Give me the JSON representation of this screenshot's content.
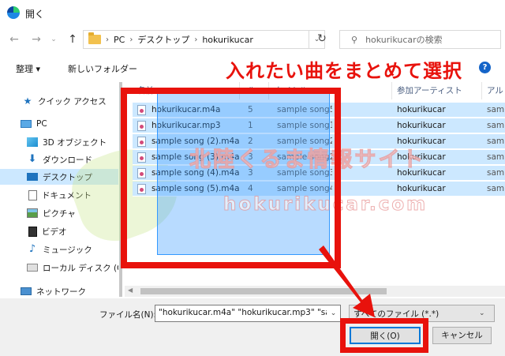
{
  "window": {
    "title": "開く"
  },
  "nav": {
    "back_icon": "arrow-left-icon",
    "forward_icon": "arrow-right-icon",
    "recent_icon": "chevron-down-icon",
    "up_icon": "arrow-up-icon",
    "breadcrumb": [
      "PC",
      "デスクトップ",
      "hokurikucar"
    ],
    "search_placeholder": "hokurikucarの検索"
  },
  "toolbar": {
    "organize": "整理 ▾",
    "new_folder": "新しいフォルダー"
  },
  "annotation": {
    "headline": "入れたい曲をまとめて選択"
  },
  "sidebar": {
    "items": [
      {
        "label": "クイック アクセス",
        "icon": "star-icon"
      },
      {
        "label": "PC",
        "icon": "pc-icon"
      },
      {
        "label": "3D オブジェクト",
        "icon": "3d-objects-icon"
      },
      {
        "label": "ダウンロード",
        "icon": "download-icon"
      },
      {
        "label": "デスクトップ",
        "icon": "desktop-icon"
      },
      {
        "label": "ドキュメント",
        "icon": "documents-icon"
      },
      {
        "label": "ピクチャ",
        "icon": "pictures-icon"
      },
      {
        "label": "ビデオ",
        "icon": "videos-icon"
      },
      {
        "label": "ミュージック",
        "icon": "music-icon"
      },
      {
        "label": "ローカル ディスク (C",
        "icon": "disk-icon"
      },
      {
        "label": "ネットワーク",
        "icon": "network-icon"
      }
    ]
  },
  "filelist": {
    "columns": [
      "名前",
      "#",
      "タイトル",
      "参加アーティスト",
      "アル"
    ],
    "rows": [
      {
        "name": "hokurikucar.m4a",
        "num": "5",
        "title": "sample song5",
        "artist": "hokurikucar",
        "album": "sam"
      },
      {
        "name": "hokurikucar.mp3",
        "num": "1",
        "title": "sample song1",
        "artist": "hokurikucar",
        "album": "sam"
      },
      {
        "name": "sample song (2).m4a",
        "num": "2",
        "title": "sample song2",
        "artist": "hokurikucar",
        "album": "sam"
      },
      {
        "name": "sample song (3).m4a",
        "num": "3",
        "title": "sample song2",
        "artist": "hokurikucar",
        "album": "sam"
      },
      {
        "name": "sample song (4).m4a",
        "num": "3",
        "title": "sample song3",
        "artist": "hokurikucar",
        "album": "sam"
      },
      {
        "name": "sample song (5).m4a",
        "num": "4",
        "title": "sample song4",
        "artist": "hokurikucar",
        "album": "sam"
      }
    ]
  },
  "watermark": {
    "jp": "北陸くるま情報サイト",
    "en": "hokurikucar.com"
  },
  "footer": {
    "filename_label": "ファイル名(N):",
    "filename_value": "\"hokurikucar.m4a\" \"hokurikucar.mp3\" \"sam",
    "filetype_value": "すべてのファイル (*.*)",
    "open_button": "開く(O)",
    "cancel_button": "キャンセル"
  },
  "colors": {
    "accent_red": "#e8120c",
    "selection": "#cce8ff",
    "focus_blue": "#0078d7"
  }
}
